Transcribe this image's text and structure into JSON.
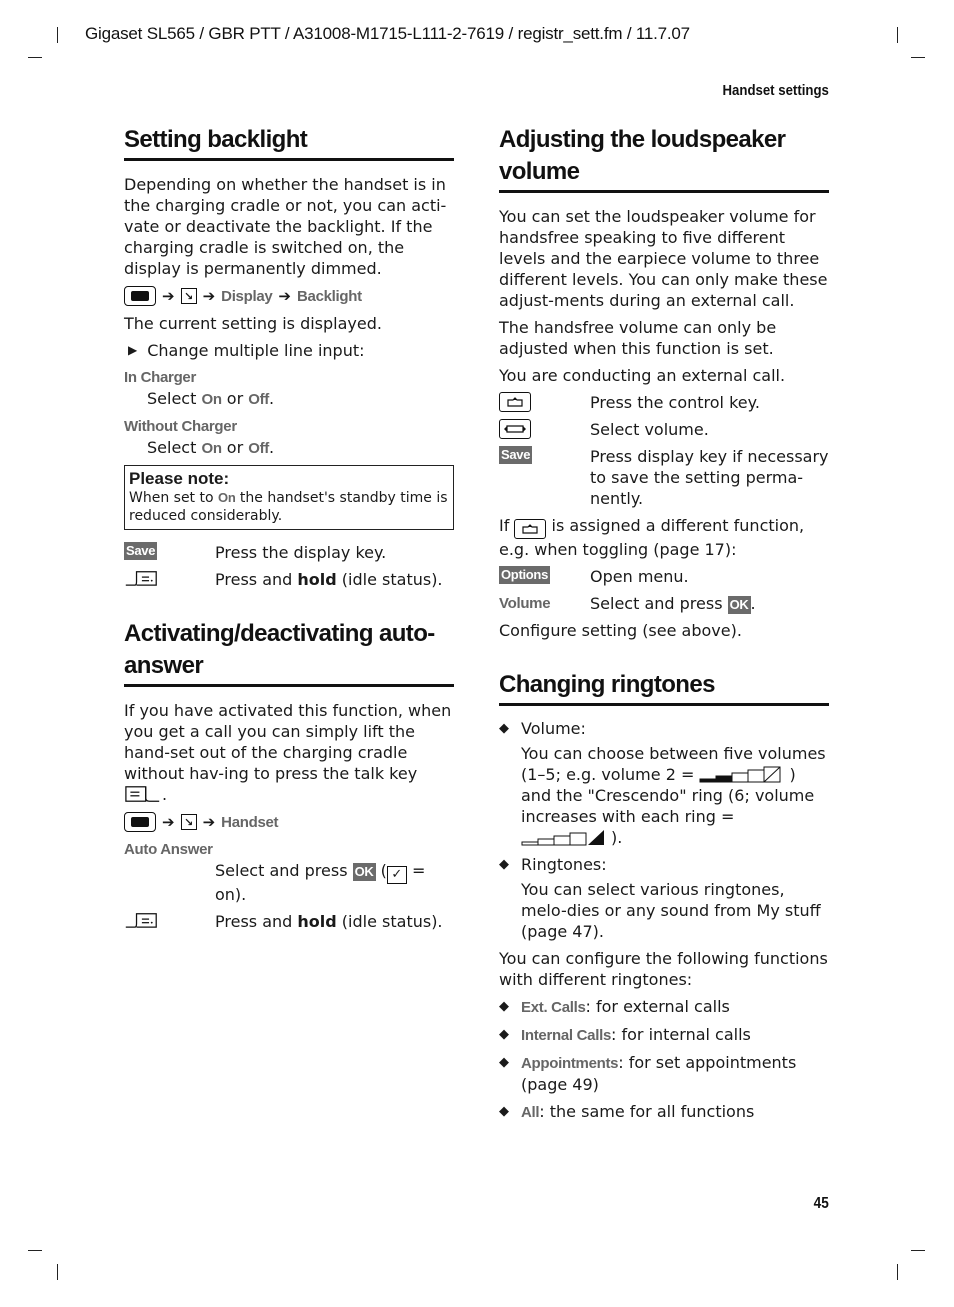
{
  "header": {
    "doc_line": "Gigaset SL565 / GBR PTT / A31008-M1715-L111-2-7619 / registr_sett.fm / 11.7.07",
    "running_title": "Handset settings",
    "page_number": "45"
  },
  "left": {
    "backlight": {
      "title": "Setting backlight",
      "intro": "Depending on whether the handset is in the charging cradle or not, you can acti-vate or deactivate the backlight. If the charging cradle is switched on, the display is permanently dimmed.",
      "path": [
        "menu-key-icon",
        "settings-key-icon",
        "Display",
        "Backlight"
      ],
      "path_menu_1": "Display",
      "path_menu_2": "Backlight",
      "current": "The current setting is displayed.",
      "step": "Change multiple line input:",
      "options": [
        {
          "label": "In Charger",
          "select_pre": "Select ",
          "on": "On",
          "or": " or ",
          "off": "Off",
          "end": "."
        },
        {
          "label": "Without Charger",
          "select_pre": "Select ",
          "on": "On",
          "or": " or ",
          "off": "Off",
          "end": "."
        }
      ],
      "note": {
        "title": "Please note:",
        "pre": "When set to ",
        "on": "On",
        "post": " the handset's standby time is reduced considerably."
      },
      "rows": [
        {
          "key": "Save",
          "text": "Press the display key."
        },
        {
          "key": "end-call-key-icon",
          "pre": "Press and ",
          "bold": "hold",
          "post": " (idle status)."
        }
      ]
    },
    "autoanswer": {
      "title": "Activating/deactivating auto-answer",
      "intro": "If you have activated this function, when you get a call you can simply lift the hand-set out of the charging cradle without hav-ing to press the talk key",
      "intro_end": ".",
      "path_menu_1": "Handset",
      "option_label": "Auto Answer",
      "select_pre": "Select and press ",
      "ok": "OK",
      "select_mid": " (",
      "check": "✓",
      "select_post": " = on).",
      "row": {
        "pre": "Press and ",
        "bold": "hold",
        "post": " (idle status)."
      }
    }
  },
  "right": {
    "loudspeaker": {
      "title": "Adjusting the loudspeaker volume",
      "intro": "You can set the loudspeaker volume for handsfree speaking to five different levels and the earpiece volume to three different levels. You can only make these adjust-ments during an external call.",
      "p2": "The handsfree volume can only be adjusted when this function is set.",
      "p3": "You are conducting an external call.",
      "rows": [
        {
          "key": "control-key-up-icon",
          "text": "Press the control key."
        },
        {
          "key": "control-key-leftright-icon",
          "text": "Select volume."
        },
        {
          "key": "Save",
          "text": "Press display key if necessary to save the setting perma-nently."
        }
      ],
      "if_pre": "If",
      "if_post": "is assigned a different function, e.g. when toggling (page 17):",
      "rows2": [
        {
          "key": "Options",
          "text": "Open menu."
        },
        {
          "key": "Volume",
          "pre": "Select and press ",
          "ok": "OK",
          "post": "."
        }
      ],
      "configure": "Configure setting (see above)."
    },
    "ringtones": {
      "title": "Changing ringtones",
      "volume_label": "Volume:",
      "volume_desc_1": "You can choose between five volumes (1–5; e.g. volume 2 =",
      "volume_desc_2": ") and the \"Crescendo\" ring (6; volume increases with each ring =",
      "volume_desc_3": ").",
      "example_volume_level": 2,
      "example_volume_max": 5,
      "ringtones_label": "Ringtones:",
      "ringtones_desc": "You can select various ringtones, melo-dies or any sound from My stuff (page 47).",
      "configure_intro": "You can configure the following functions with different ringtones:",
      "functions": [
        {
          "name": "Ext. Calls",
          "desc": ": for external calls"
        },
        {
          "name": "Internal Calls",
          "desc": ": for internal calls"
        },
        {
          "name": "Appointments",
          "desc": ": for set appointments (page 49)"
        },
        {
          "name": "All",
          "desc": ": the same for all functions"
        }
      ]
    }
  }
}
